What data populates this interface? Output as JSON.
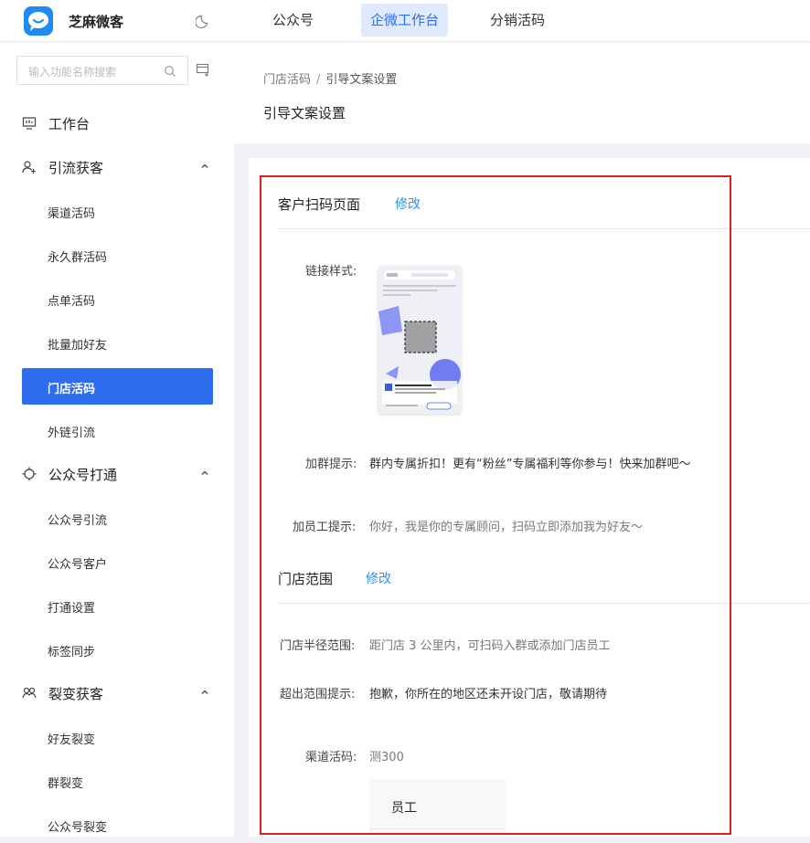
{
  "app": {
    "brand": "芝麻微客"
  },
  "topnav": [
    {
      "label": "公众号",
      "active": false
    },
    {
      "label": "企微工作台",
      "active": true
    },
    {
      "label": "分销活码",
      "active": false
    }
  ],
  "sidebar": {
    "search_placeholder": "输入功能名称搜索",
    "groups": [
      {
        "label": "工作台",
        "icon": "monitor-icon",
        "items": []
      },
      {
        "label": "引流获客",
        "icon": "user-add-icon",
        "items": [
          "渠道活码",
          "永久群活码",
          "点单活码",
          "批量加好友",
          "门店活码",
          "外链引流"
        ]
      },
      {
        "label": "公众号打通",
        "icon": "crosshair-icon",
        "items": [
          "公众号引流",
          "公众号客户",
          "打通设置",
          "标签同步"
        ]
      },
      {
        "label": "裂变获客",
        "icon": "users-icon",
        "items": [
          "好友裂变",
          "群裂变",
          "公众号裂变"
        ]
      }
    ],
    "active_item": "门店活码"
  },
  "breadcrumb": {
    "parent": "门店活码",
    "separator": "/",
    "current": "引导文案设置"
  },
  "page_title": "引导文案设置",
  "section_scan": {
    "title": "客户扫码页面",
    "edit_label": "修改",
    "link_style_label": "链接样式:",
    "group_tip_label": "加群提示:",
    "group_tip_value": "群内专属折扣！更有“粉丝”专属福利等你参与！快来加群吧～",
    "staff_tip_label": "加员工提示:",
    "staff_tip_value": "你好，我是你的专属顾问，扫码立即添加我为好友～"
  },
  "section_store": {
    "title": "门店范围",
    "edit_label": "修改",
    "radius_label": "门店半径范围:",
    "radius_value": "距门店 3 公里内，可扫码入群或添加门店员工",
    "out_of_range_label": "超出范围提示:",
    "out_of_range_value": "抱歉，你所在的地区还未开设门店，敬请期待",
    "channel_code_label": "渠道活码:",
    "channel_code_value": "测300",
    "table_header": "员工"
  },
  "colors": {
    "accent": "#2f6df0",
    "link": "#2f8ef0",
    "highlight_border": "#e02020"
  }
}
